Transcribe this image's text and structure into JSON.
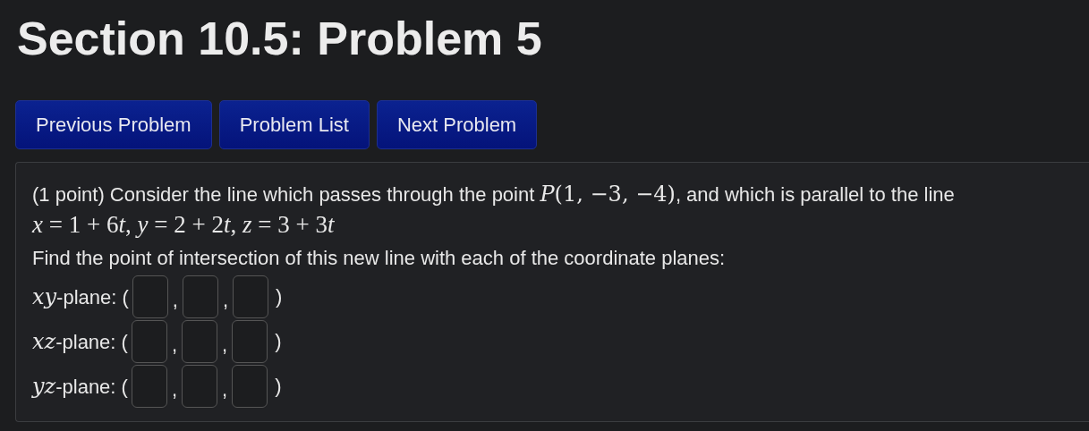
{
  "title": "Section 10.5: Problem 5",
  "buttons": [
    {
      "label": "Previous Problem"
    },
    {
      "label": "Problem List"
    },
    {
      "label": "Next Problem"
    }
  ],
  "problem": {
    "intro": [
      {
        "kind": "text",
        "text": "(1 point) Consider the line which passes through the point "
      },
      {
        "kind": "math",
        "text": "*P*(1, −3, −4)"
      },
      {
        "kind": "text",
        "text": ", and which is parallel to the line"
      }
    ],
    "equation": [
      {
        "kind": "var",
        "text": "x"
      },
      {
        "kind": "plain",
        "text": " = 1 + 6"
      },
      {
        "kind": "var",
        "text": "t"
      },
      {
        "kind": "plain",
        "text": ", "
      },
      {
        "kind": "var",
        "text": "y"
      },
      {
        "kind": "plain",
        "text": " = 2 + 2"
      },
      {
        "kind": "var",
        "text": "t"
      },
      {
        "kind": "plain",
        "text": ", "
      },
      {
        "kind": "var",
        "text": "z"
      },
      {
        "kind": "plain",
        "text": " = 3 + 3"
      },
      {
        "kind": "var",
        "text": "t"
      }
    ],
    "instruction": "Find the point of intersection of this new line with each of the coordinate planes:",
    "rows": [
      {
        "variables": "xy",
        "label": "-plane: (",
        "fields": [
          {
            "kind": "answer"
          },
          {
            "kind": "answer"
          },
          {
            "kind": "answer"
          }
        ],
        "separators": [
          ",",
          ","
        ],
        "close": ")"
      },
      {
        "variables": "xz",
        "label": "-plane: (",
        "fields": [
          {
            "kind": "answer"
          },
          {
            "kind": "answer"
          },
          {
            "kind": "answer"
          }
        ],
        "separators": [
          ",",
          ","
        ],
        "close": ")"
      },
      {
        "variables": "yz",
        "label": "-plane: (",
        "fields": [
          {
            "kind": "answer"
          },
          {
            "kind": "answer"
          },
          {
            "kind": "answer"
          }
        ],
        "separators": [
          ",",
          ","
        ],
        "close": ")"
      }
    ]
  }
}
